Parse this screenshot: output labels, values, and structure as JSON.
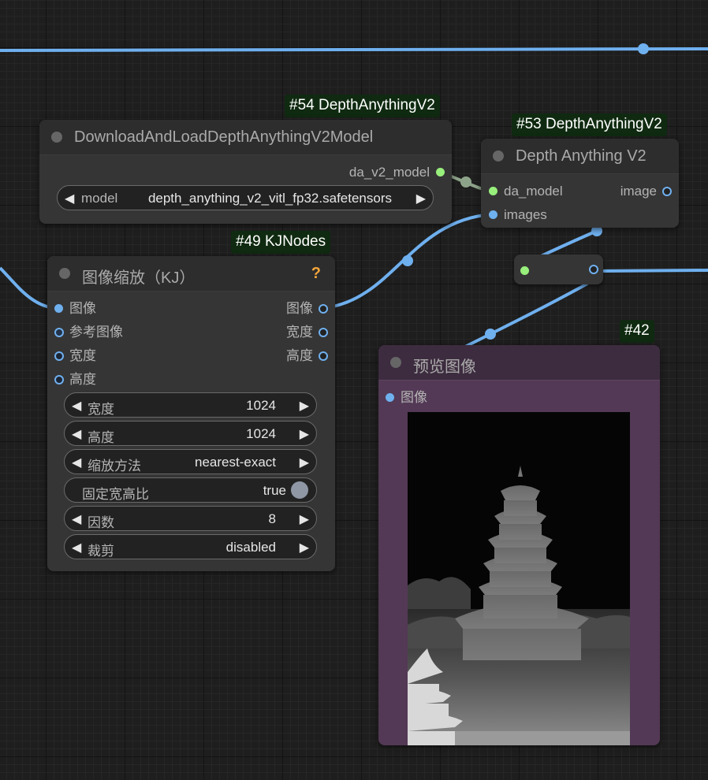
{
  "nodes": {
    "n54": {
      "badge": "#54 DepthAnythingV2",
      "title": "DownloadAndLoadDepthAnythingV2Model",
      "output_label": "da_v2_model",
      "widget": {
        "label": "model",
        "value": "depth_anything_v2_vitl_fp32.safetensors"
      }
    },
    "n53": {
      "badge": "#53 DepthAnythingV2",
      "title": "Depth Anything V2",
      "inputs": [
        "da_model",
        "images"
      ],
      "output_label": "image"
    },
    "n49": {
      "badge": "#49 KJNodes",
      "title": "图像缩放（KJ）",
      "help": "?",
      "inputs": [
        "图像",
        "参考图像",
        "宽度",
        "高度"
      ],
      "outputs": [
        "图像",
        "宽度",
        "高度"
      ],
      "widgets": [
        {
          "label": "宽度",
          "value": "1024"
        },
        {
          "label": "高度",
          "value": "1024"
        },
        {
          "label": "缩放方法",
          "value": "nearest-exact"
        },
        {
          "label": "固定宽高比",
          "value": "true"
        },
        {
          "label": "因数",
          "value": "8"
        },
        {
          "label": "裁剪",
          "value": "disabled"
        }
      ]
    },
    "n42": {
      "badge": "#42",
      "title": "预览图像",
      "input_label": "图像"
    }
  },
  "colors": {
    "link_image": "#6fb0ef",
    "link_model": "#98ef7c",
    "preview_body": "#533955",
    "badge_bg": "#0f2a10"
  }
}
